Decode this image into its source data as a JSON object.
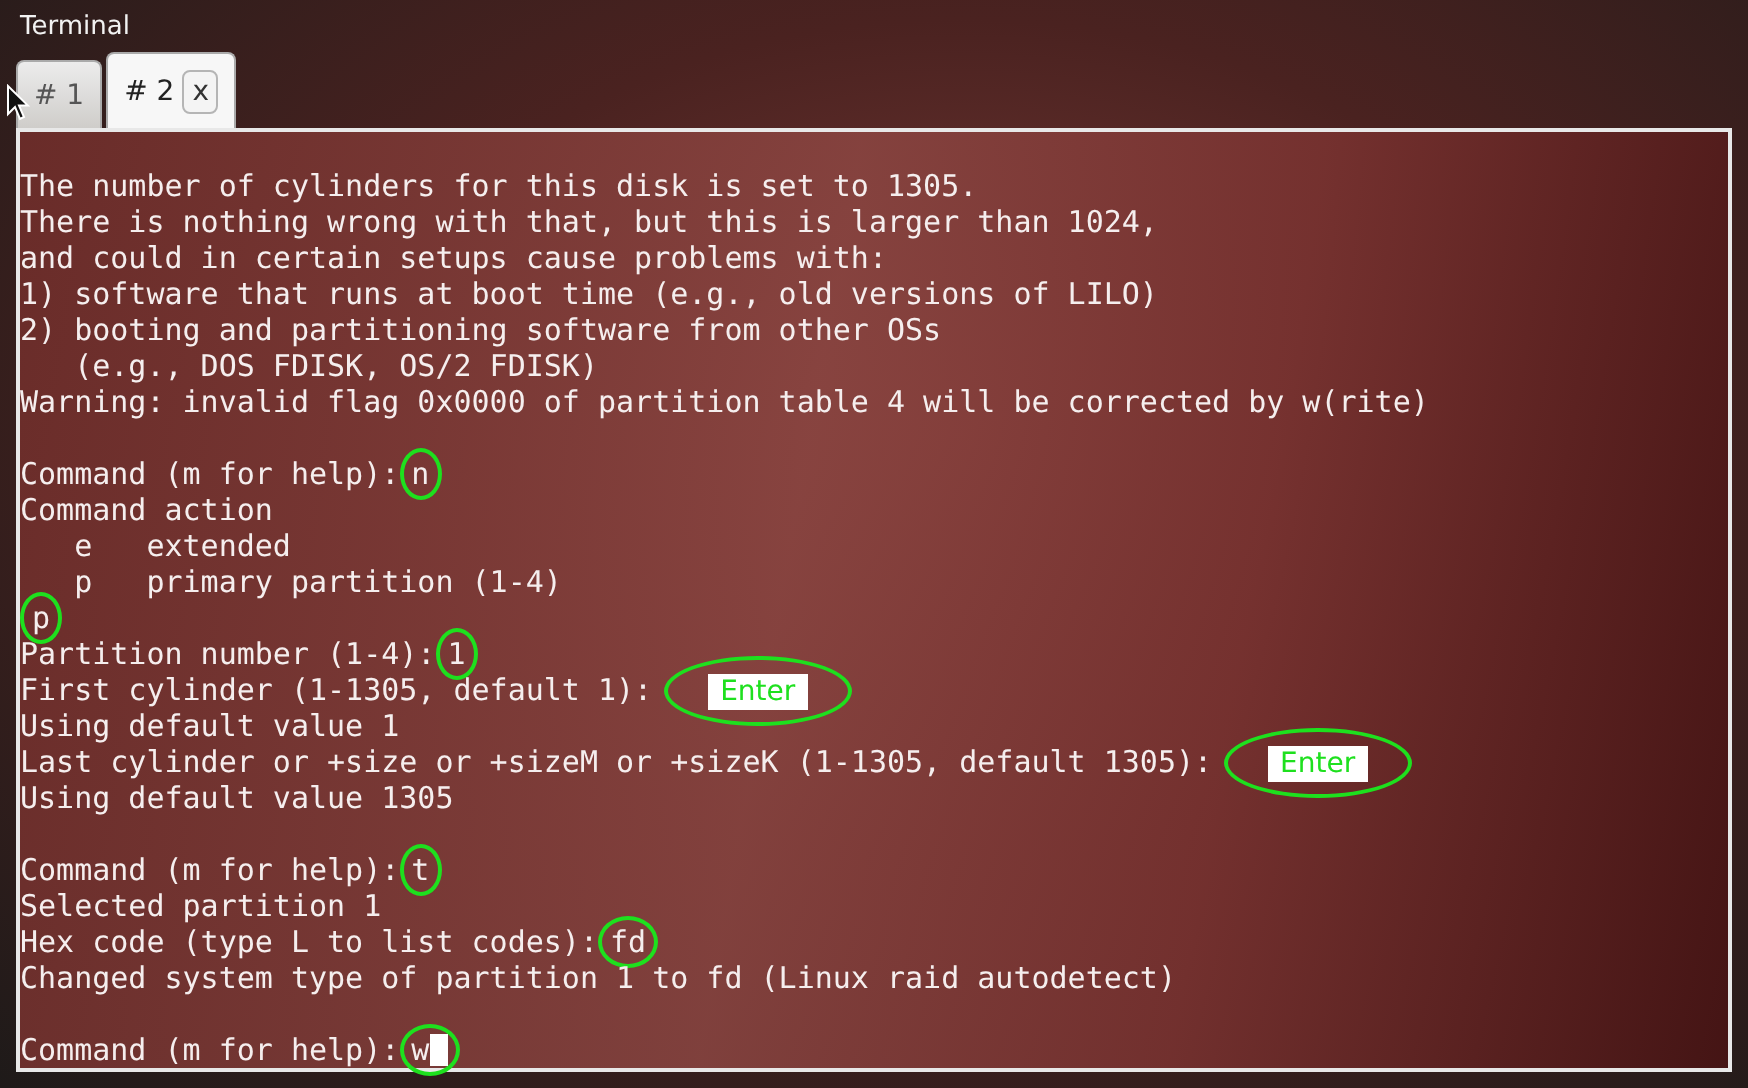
{
  "window": {
    "title": "Terminal"
  },
  "tabs": [
    {
      "label": "# 1",
      "selected": false,
      "closable": false
    },
    {
      "label": "# 2",
      "selected": true,
      "closable": true,
      "close_label": "x"
    }
  ],
  "terminal": {
    "lines": [
      {
        "kind": "output",
        "text": "The number of cylinders for this disk is set to 1305."
      },
      {
        "kind": "output",
        "text": "There is nothing wrong with that, but this is larger than 1024,"
      },
      {
        "kind": "output",
        "text": "and could in certain setups cause problems with:"
      },
      {
        "kind": "output",
        "text": "1) software that runs at boot time (e.g., old versions of LILO)"
      },
      {
        "kind": "output",
        "text": "2) booting and partitioning software from other OSs"
      },
      {
        "kind": "output",
        "text": "   (e.g., DOS FDISK, OS/2 FDISK)"
      },
      {
        "kind": "output",
        "text": "Warning: invalid flag 0x0000 of partition table 4 will be corrected by w(rite)"
      },
      {
        "kind": "blank"
      },
      {
        "kind": "prompt",
        "text": "Command (m for help):",
        "input": "n"
      },
      {
        "kind": "output",
        "text": "Command action"
      },
      {
        "kind": "output",
        "text": "   e   extended"
      },
      {
        "kind": "output",
        "text": "   p   primary partition (1-4)"
      },
      {
        "kind": "prompt",
        "input": "p"
      },
      {
        "kind": "prompt",
        "text": "Partition number (1-4):",
        "input": "1"
      },
      {
        "kind": "key",
        "text": "First cylinder (1-1305, default 1):",
        "key": "Enter"
      },
      {
        "kind": "output",
        "text": "Using default value 1"
      },
      {
        "kind": "key",
        "text": "Last cylinder or +size or +sizeM or +sizeK (1-1305, default 1305):",
        "key": "Enter"
      },
      {
        "kind": "output",
        "text": "Using default value 1305"
      },
      {
        "kind": "blank"
      },
      {
        "kind": "prompt",
        "text": "Command (m for help):",
        "input": "t"
      },
      {
        "kind": "output",
        "text": "Selected partition 1"
      },
      {
        "kind": "prompt",
        "text": "Hex code (type L to list codes):",
        "input": "fd"
      },
      {
        "kind": "output",
        "text": "Changed system type of partition 1 to fd (Linux raid autodetect)"
      },
      {
        "kind": "blank"
      },
      {
        "kind": "prompt",
        "text": "Command (m for help):",
        "input": "w",
        "cursor": true
      }
    ]
  }
}
